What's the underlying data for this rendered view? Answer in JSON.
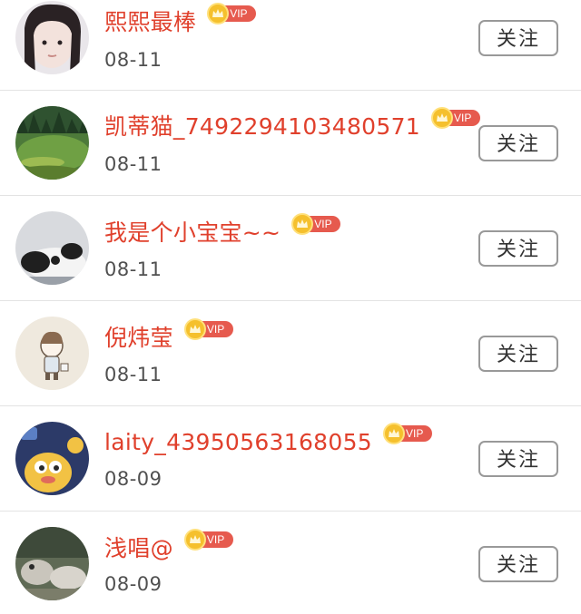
{
  "follow_label": "关注",
  "vip_label": "VIP",
  "users": [
    {
      "name": "熙熙最棒",
      "date": "08-11"
    },
    {
      "name": "凯蒂猫_7492294103480571",
      "date": "08-11"
    },
    {
      "name": "我是个小宝宝~~",
      "date": "08-11"
    },
    {
      "name": "倪炜莹",
      "date": "08-11"
    },
    {
      "name": "laity_43950563168055",
      "date": "08-09"
    },
    {
      "name": "浅唱@",
      "date": "08-09"
    }
  ],
  "colors": {
    "username": "#e0402c",
    "vip_badge": "#e65a4e",
    "vip_coin": "#f5c02d",
    "date": "#505050",
    "button_border": "#999999"
  }
}
